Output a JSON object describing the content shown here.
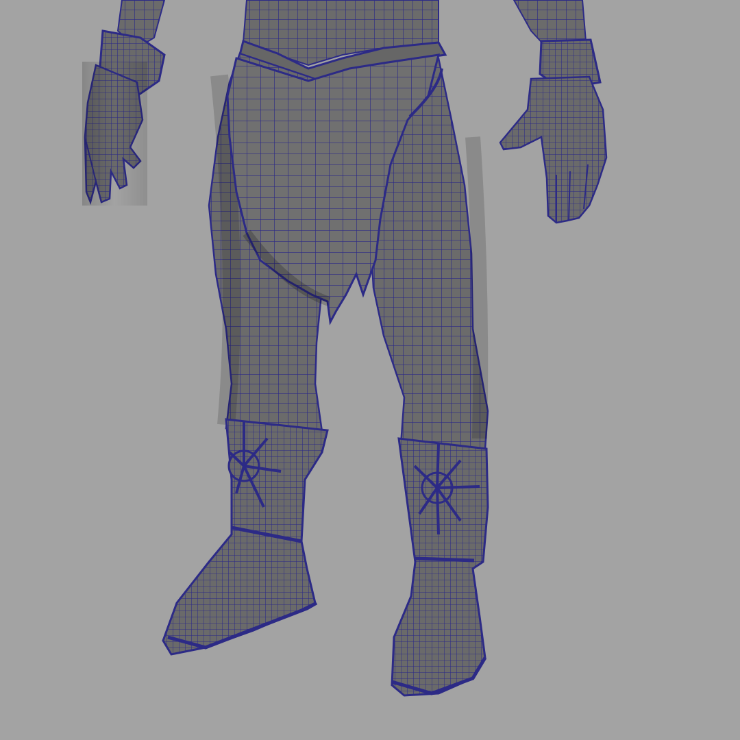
{
  "viewport": {
    "background_color": "#a3a3a3",
    "shading": "shaded-with-wireframe"
  },
  "model": {
    "surface_color": "#6d6d6d",
    "wire_color": "#2c2a86",
    "parts": [
      "left-hand",
      "right-hand",
      "left-bracer",
      "right-bracer",
      "torso",
      "loincloth",
      "left-leg",
      "right-leg",
      "left-boot",
      "right-boot",
      "left-sun-emblem",
      "right-sun-emblem"
    ]
  }
}
